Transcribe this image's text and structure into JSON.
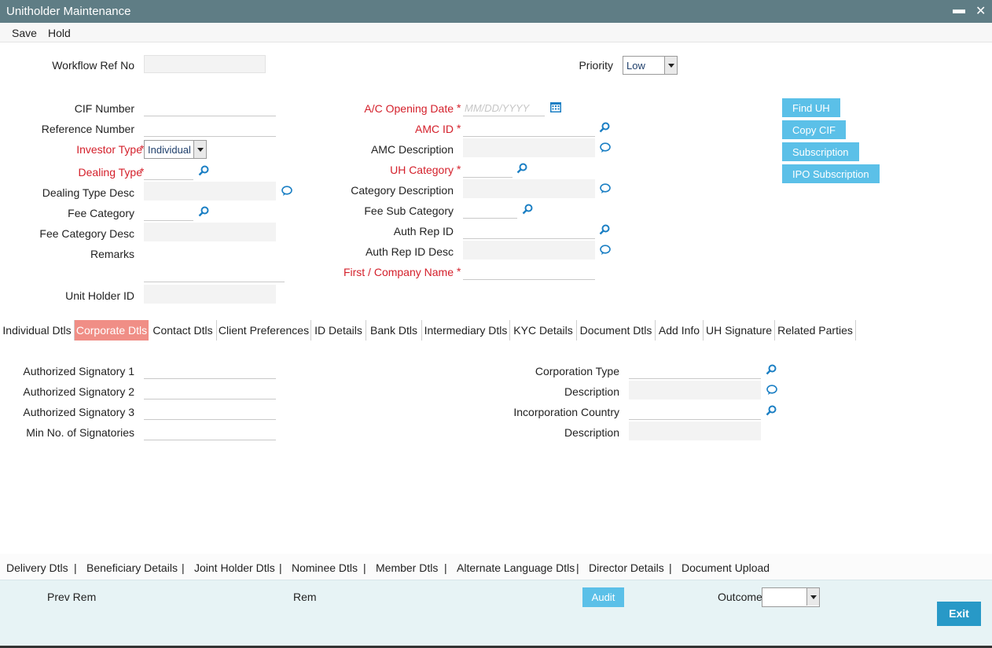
{
  "window": {
    "title": "Unitholder Maintenance",
    "minimize": "▬",
    "close": "✕"
  },
  "menu": {
    "save": "Save",
    "hold": "Hold"
  },
  "header": {
    "workflow_ref_label": "Workflow Ref No",
    "workflow_ref_value": "",
    "priority_label": "Priority",
    "priority_value": "Low"
  },
  "left_fields": {
    "cif_number": "CIF Number",
    "reference_number": "Reference Number",
    "investor_type": "Investor Type",
    "investor_type_value": "Individual",
    "dealing_type": "Dealing Type",
    "dealing_type_desc": "Dealing Type Desc",
    "fee_category": "Fee Category",
    "fee_category_desc": "Fee Category Desc",
    "remarks": "Remarks",
    "unit_holder_id": "Unit Holder ID"
  },
  "middle_fields": {
    "ac_opening_date": "A/C Opening Date",
    "ac_opening_date_placeholder": "MM/DD/YYYY",
    "amc_id": "AMC ID",
    "amc_description": "AMC Description",
    "uh_category": "UH Category",
    "category_description": "Category Description",
    "fee_sub_category": "Fee Sub Category",
    "auth_rep_id": "Auth Rep ID",
    "auth_rep_id_desc": "Auth Rep ID Desc",
    "first_company_name": "First / Company Name",
    "required_mark": "*"
  },
  "side_buttons": {
    "find_uh": "Find UH",
    "copy_cif": "Copy CIF",
    "subscription": "Subscription",
    "ipo_subscription": "IPO Subscription"
  },
  "tabs": [
    {
      "label": "Individual Dtls"
    },
    {
      "label": "Corporate Dtls"
    },
    {
      "label": "Contact Dtls"
    },
    {
      "label": "Client Preferences"
    },
    {
      "label": "ID Details"
    },
    {
      "label": "Bank Dtls"
    },
    {
      "label": "Intermediary Dtls"
    },
    {
      "label": "KYC Details"
    },
    {
      "label": "Document Dtls"
    },
    {
      "label": "Add Info"
    },
    {
      "label": "UH Signature"
    },
    {
      "label": "Related Parties"
    }
  ],
  "active_tab": "Corporate Dtls",
  "corporate": {
    "auth_sig_1": "Authorized Signatory 1",
    "auth_sig_2": "Authorized Signatory 2",
    "auth_sig_3": "Authorized Signatory 3",
    "min_signatories": "Min No. of Signatories",
    "corporation_type": "Corporation Type",
    "description_1": "Description",
    "incorporation_country": "Incorporation Country",
    "description_2": "Description"
  },
  "bottom_links": [
    {
      "label": "Delivery Dtls"
    },
    {
      "label": "Beneficiary Details"
    },
    {
      "label": "Joint Holder Dtls"
    },
    {
      "label": "Nominee Dtls"
    },
    {
      "label": "Member Dtls"
    },
    {
      "label": "Alternate Language Dtls"
    },
    {
      "label": "Director Details"
    },
    {
      "label": "Document Upload"
    }
  ],
  "link_separator": "|",
  "footer": {
    "prev_rem": "Prev Rem",
    "rem": "Rem",
    "audit": "Audit",
    "outcome": "Outcome",
    "outcome_value": "",
    "exit": "Exit"
  },
  "colors": {
    "titlebar": "#5f7d85",
    "required": "#d4202b",
    "side_button": "#5bc0e8",
    "active_tab": "#f08e86",
    "exit_button": "#2899c7",
    "footer_bg": "#e7f3f5",
    "icon": "#1b7fc4"
  }
}
